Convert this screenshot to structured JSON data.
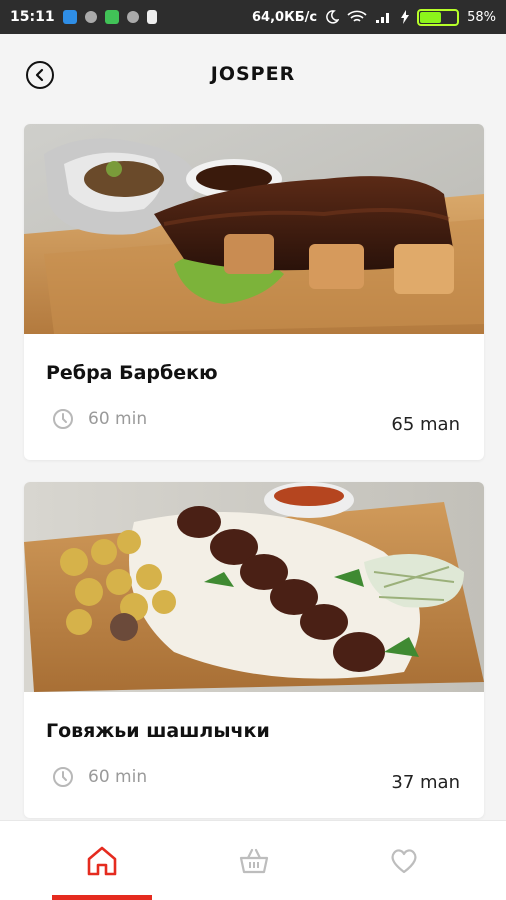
{
  "status_bar": {
    "time": "15:11",
    "speed": "64,0КБ/с",
    "battery_percent": "58%",
    "battery_level": 0.58
  },
  "header": {
    "title": "JOSPER"
  },
  "items": [
    {
      "title": "Ребра Барбекю",
      "time": "60 min",
      "price": "65 man"
    },
    {
      "title": "Говяжьи шашлычки",
      "time": "60 min",
      "price": "37 man"
    }
  ],
  "colors": {
    "accent": "#e52b1f",
    "background": "#f4f4f4",
    "status_bar": "#2d2d2d"
  },
  "nav": {
    "active": "home",
    "items": [
      "home-icon",
      "basket-icon",
      "heart-icon"
    ]
  }
}
